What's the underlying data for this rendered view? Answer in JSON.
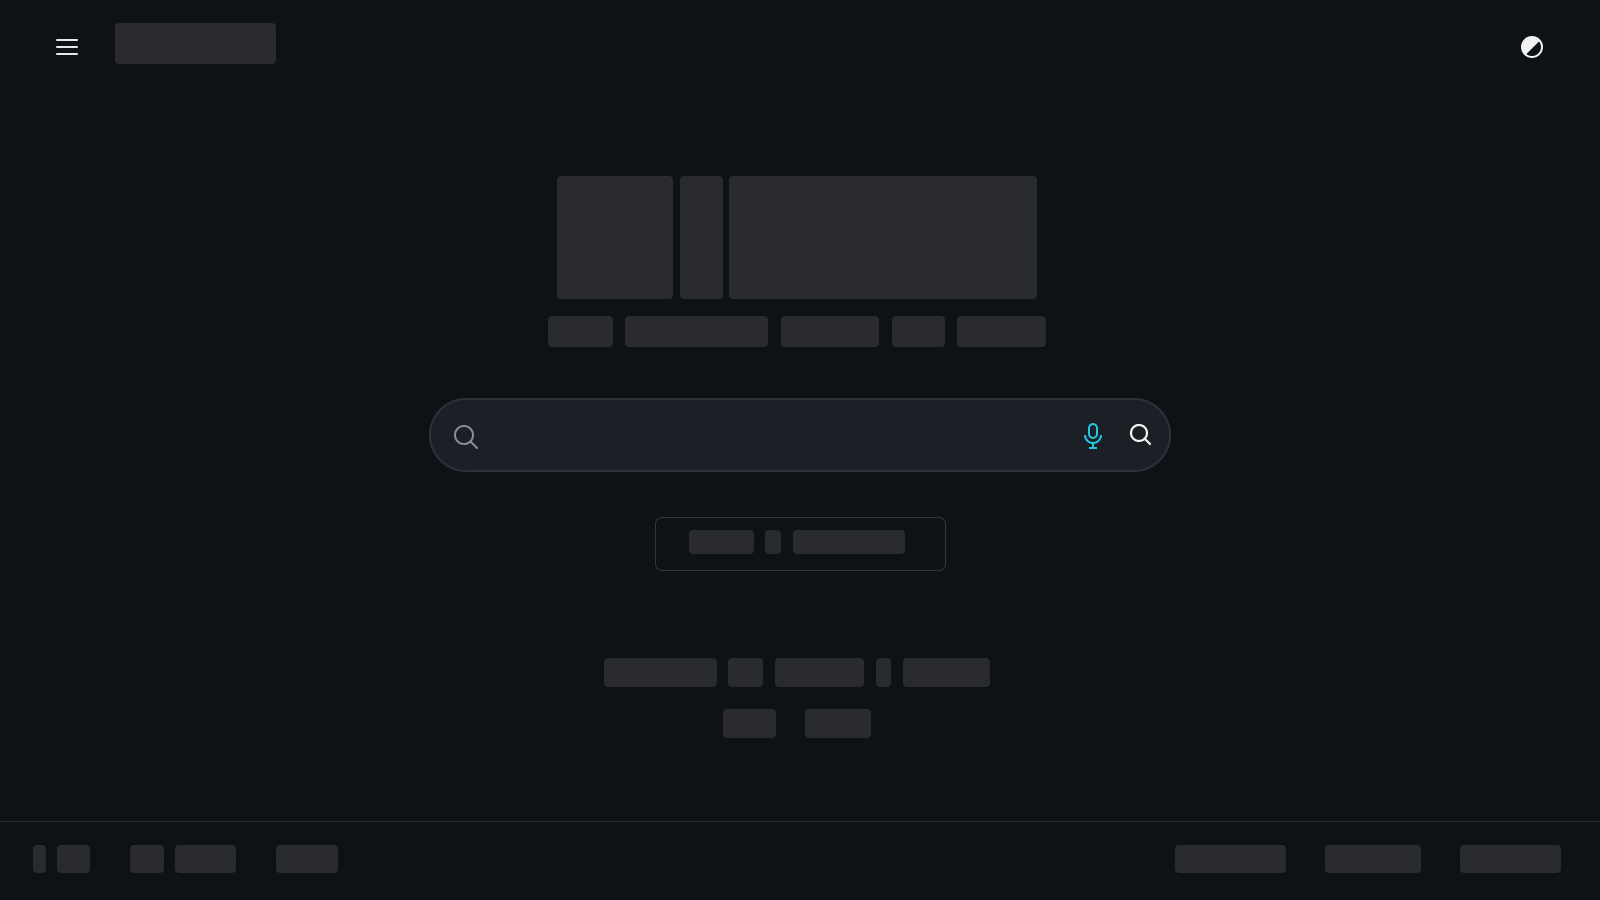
{
  "header": {
    "menu_icon": "hamburger-menu-icon",
    "theme_icon": "contrast-half-circle-icon"
  },
  "search": {
    "value": "",
    "placeholder": "",
    "left_icon": "search-icon",
    "voice_icon": "microphone-icon",
    "submit_icon": "search-icon"
  },
  "colors": {
    "background": "#0e1116",
    "skeleton": "#2a2b30",
    "search_background": "#1c1f26",
    "accent": "#22c7e0"
  }
}
